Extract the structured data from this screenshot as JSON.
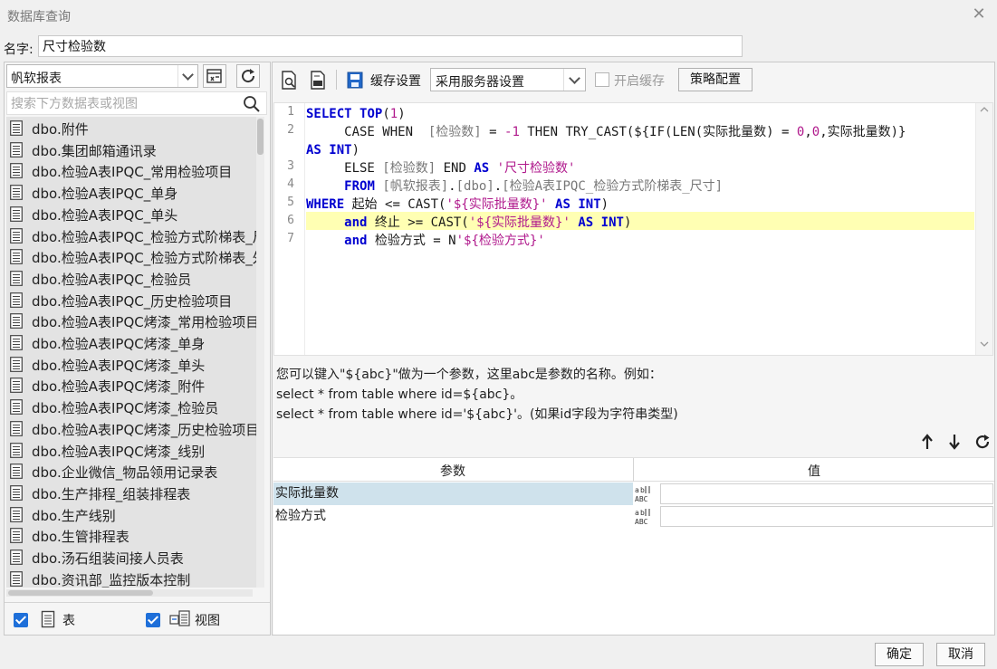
{
  "window": {
    "title": "数据库查询"
  },
  "name_row": {
    "label": "名字:",
    "value": "尺寸检验数"
  },
  "left": {
    "datasource": "帆软报表",
    "search_placeholder": "搜索下方数据表或视图",
    "tables": [
      "dbo.附件",
      "dbo.集团邮箱通讯录",
      "dbo.检验A表IPQC_常用检验项目",
      "dbo.检验A表IPQC_单身",
      "dbo.检验A表IPQC_单头",
      "dbo.检验A表IPQC_检验方式阶梯表_尺寸",
      "dbo.检验A表IPQC_检验方式阶梯表_外观",
      "dbo.检验A表IPQC_检验员",
      "dbo.检验A表IPQC_历史检验项目",
      "dbo.检验A表IPQC烤漆_常用检验项目",
      "dbo.检验A表IPQC烤漆_单身",
      "dbo.检验A表IPQC烤漆_单头",
      "dbo.检验A表IPQC烤漆_附件",
      "dbo.检验A表IPQC烤漆_检验员",
      "dbo.检验A表IPQC烤漆_历史检验项目",
      "dbo.检验A表IPQC烤漆_线别",
      "dbo.企业微信_物品领用记录表",
      "dbo.生产排程_组装排程表",
      "dbo.生产线别",
      "dbo.生管排程表",
      "dbo.汤石组装间接人员表",
      "dbo.资讯部_监控版本控制"
    ],
    "filter_table_label": "表",
    "filter_view_label": "视图",
    "filter_table_checked": true,
    "filter_view_checked": true
  },
  "toolbar": {
    "cache_label": "缓存设置",
    "cache_option": "采用服务器设置",
    "enable_cache_label": "开启缓存",
    "enable_cache_checked": false,
    "policy_button": "策略配置"
  },
  "editor": {
    "line_numbers": [
      "1",
      "2",
      "3",
      "4",
      "5",
      "6",
      "7"
    ],
    "highlighted_line": 6,
    "sql": [
      "SELECT TOP(1)",
      "     CASE WHEN  [检验数] = -1 THEN TRY_CAST(${IF(LEN(实际批量数) = 0,0,实际批量数)}",
      "AS INT)",
      "     ELSE [检验数] END AS '尺寸检验数'",
      "     FROM [帆软报表].[dbo].[检验A表IPQC_检验方式阶梯表_尺寸]",
      "WHERE 起始 <= CAST('${实际批量数}' AS INT)",
      "     and 终止 >= CAST('${实际批量数}' AS INT)",
      "     and 检验方式 = N'${检验方式}'"
    ]
  },
  "hints": [
    "您可以键入\"${abc}\"做为一个参数，这里abc是参数的名称。例如：",
    "select * from table where id=${abc}。",
    "select * from table where id='${abc}'。(如果id字段为字符串类型)"
  ],
  "params": {
    "col_param": "参数",
    "col_value": "值",
    "rows": [
      {
        "name": "实际批量数",
        "type_icon": "ABC",
        "value": "",
        "selected": true
      },
      {
        "name": "检验方式",
        "type_icon": "ABC",
        "value": "",
        "selected": false
      }
    ]
  },
  "footer": {
    "ok": "确定",
    "cancel": "取消"
  },
  "colors": {
    "keyword": "#0000d0",
    "string": "#b0198c",
    "highlight": "#ffffb3",
    "selected_row": "#cfe2ec",
    "checkbox": "#1e6fd9"
  }
}
